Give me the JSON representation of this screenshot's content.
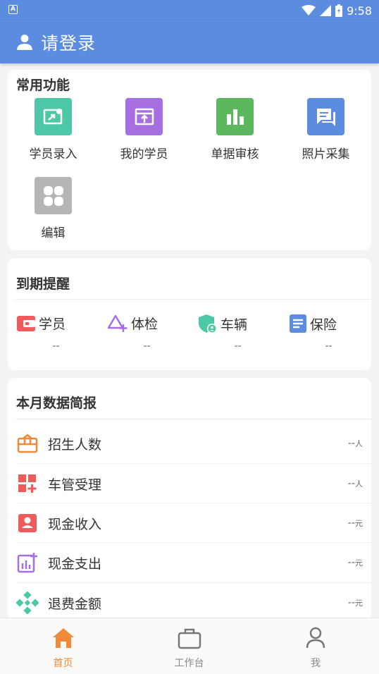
{
  "status_bar": {
    "time": "9:58",
    "notification_icon_letter": "A"
  },
  "header": {
    "title": "请登录",
    "icon": "user-icon"
  },
  "common_functions": {
    "title": "常用功能",
    "items": [
      {
        "label": "学员录入",
        "icon": "student-entry-icon",
        "color": "#4dc8a7"
      },
      {
        "label": "我的学员",
        "icon": "my-students-icon",
        "color": "#a66fe0"
      },
      {
        "label": "单据审核",
        "icon": "bar-chart-icon",
        "color": "#5cb85c"
      },
      {
        "label": "照片采集",
        "icon": "chat-icon",
        "color": "#5b8ce0"
      },
      {
        "label": "编辑",
        "icon": "grid-icon",
        "color": "#b5b5b5"
      }
    ]
  },
  "expiry_reminder": {
    "title": "到期提醒",
    "items": [
      {
        "label": "学员",
        "value": "--",
        "icon": "wallet-icon",
        "color": "#ef5b5b"
      },
      {
        "label": "体检",
        "value": "--",
        "icon": "triangle-plus-icon",
        "color": "#a66fe0"
      },
      {
        "label": "车辆",
        "value": "--",
        "icon": "shield-user-icon",
        "color": "#4dc8a7"
      },
      {
        "label": "保险",
        "value": "--",
        "icon": "document-icon",
        "color": "#5b8ce0"
      }
    ]
  },
  "monthly_report": {
    "title": "本月数据简报",
    "rows": [
      {
        "label": "招生人数",
        "value": "--",
        "unit": "人",
        "icon": "gift-icon",
        "color": "#ef8a3b"
      },
      {
        "label": "车管受理",
        "value": "--",
        "unit": "人",
        "icon": "grid-plus-icon",
        "color": "#ef5b5b"
      },
      {
        "label": "现金收入",
        "value": "--",
        "unit": "元",
        "icon": "id-card-icon",
        "color": "#ef5b5b"
      },
      {
        "label": "现金支出",
        "value": "--",
        "unit": "元",
        "icon": "chart-plus-icon",
        "color": "#a66fe0"
      },
      {
        "label": "退费金额",
        "value": "--",
        "unit": "元",
        "icon": "diamond-icon",
        "color": "#4dc8a7"
      }
    ]
  },
  "tab_bar": {
    "tabs": [
      {
        "label": "首页",
        "icon": "home-icon",
        "active": true
      },
      {
        "label": "工作台",
        "icon": "briefcase-icon",
        "active": false
      },
      {
        "label": "我",
        "icon": "person-icon",
        "active": false
      }
    ],
    "active_color": "#ef8a3b"
  }
}
